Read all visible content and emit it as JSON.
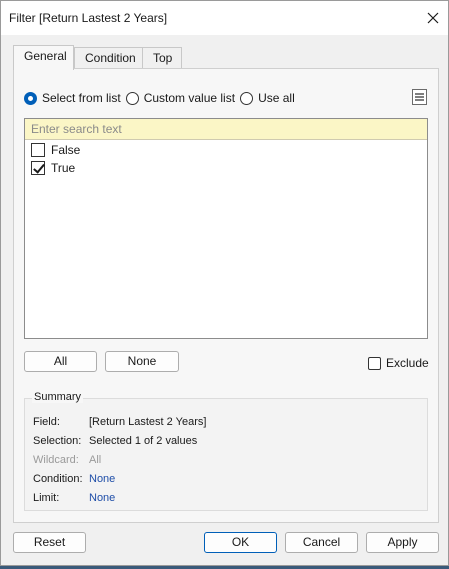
{
  "window": {
    "title": "Filter [Return Lastest 2 Years]"
  },
  "tabs": [
    {
      "label": "General",
      "active": true
    },
    {
      "label": "Condition",
      "active": false
    },
    {
      "label": "Top",
      "active": false
    }
  ],
  "mode": {
    "options": [
      {
        "label": "Select from list",
        "selected": true
      },
      {
        "label": "Custom value list",
        "selected": false
      },
      {
        "label": "Use all",
        "selected": false
      }
    ]
  },
  "search": {
    "placeholder": "Enter search text",
    "value": ""
  },
  "list_items": [
    {
      "label": "False",
      "checked": false
    },
    {
      "label": "True",
      "checked": true
    }
  ],
  "buttons": {
    "all": "All",
    "none": "None",
    "exclude": "Exclude",
    "reset": "Reset",
    "ok": "OK",
    "cancel": "Cancel",
    "apply": "Apply"
  },
  "summary": {
    "title": "Summary",
    "rows": [
      {
        "key": "Field:",
        "value": "[Return Lastest 2 Years]",
        "style": "normal"
      },
      {
        "key": "Selection:",
        "value": "Selected 1 of 2 values",
        "style": "normal"
      },
      {
        "key": "Wildcard:",
        "value": "All",
        "style": "muted"
      },
      {
        "key": "Condition:",
        "value": "None",
        "style": "link"
      },
      {
        "key": "Limit:",
        "value": "None",
        "style": "link"
      }
    ]
  },
  "colors": {
    "accent": "#005fb8",
    "search_bg": "#fbf6c6",
    "link": "#1f4ea8"
  }
}
